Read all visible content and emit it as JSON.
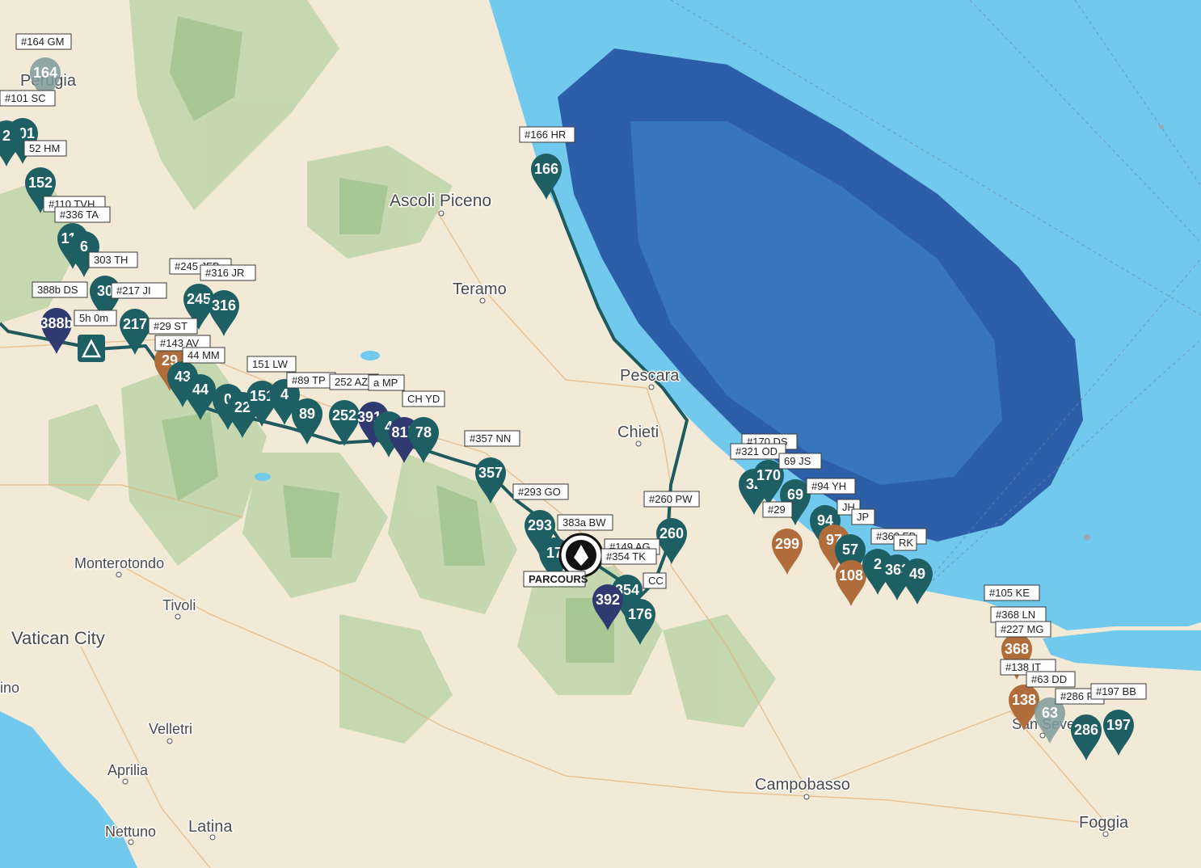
{
  "colors": {
    "sea": "#72c9ee",
    "deep_sea": "#2c5fa8",
    "land": "#f2e9d6",
    "hills": "#a9c99a",
    "route": "#1f5a5e",
    "pin_teal": "#1d5f63",
    "pin_brown": "#b06c3a",
    "pin_navy": "#2e3a70",
    "pin_grey": "#7f9b9b"
  },
  "cities": [
    {
      "name": "Perugia"
    },
    {
      "name": "Ascoli Piceno"
    },
    {
      "name": "Teramo"
    },
    {
      "name": "Pescara"
    },
    {
      "name": "Chieti"
    },
    {
      "name": "Monterotondo"
    },
    {
      "name": "Tivoli"
    },
    {
      "name": "Vatican City"
    },
    {
      "name": "Velletri"
    },
    {
      "name": "Aprilia"
    },
    {
      "name": "Nettuno"
    },
    {
      "name": "Latina"
    },
    {
      "name": "Campobasso"
    },
    {
      "name": "Foggia"
    },
    {
      "name": "San Severo"
    },
    {
      "name": "ino"
    }
  ],
  "labels": [
    {
      "text": "#164 GM"
    },
    {
      "text": "#101 SC"
    },
    {
      "text": "52 HM"
    },
    {
      "text": "#110 TVH"
    },
    {
      "text": "#336 TA"
    },
    {
      "text": "303 TH"
    },
    {
      "text": "#245 JFB"
    },
    {
      "text": "#316 JR"
    },
    {
      "text": "388b DS"
    },
    {
      "text": "#217 JI"
    },
    {
      "text": "5h 0m"
    },
    {
      "text": "#29 ST"
    },
    {
      "text": "#143 AV"
    },
    {
      "text": "44 MM"
    },
    {
      "text": "151 LW"
    },
    {
      "text": "#89 TP"
    },
    {
      "text": "252 AZ"
    },
    {
      "text": "a MP"
    },
    {
      "text": "CH YD"
    },
    {
      "text": "#166 HR"
    },
    {
      "text": "#357 NN"
    },
    {
      "text": "#293 GO"
    },
    {
      "text": "383a BW"
    },
    {
      "text": "#149 AG"
    },
    {
      "text": "#354 TK"
    },
    {
      "text": "CC"
    },
    {
      "text": "PARCOURS"
    },
    {
      "text": "#260 PW"
    },
    {
      "text": "#170 DS"
    },
    {
      "text": "#321 OD"
    },
    {
      "text": "69 JS"
    },
    {
      "text": "#94 YH"
    },
    {
      "text": "#29"
    },
    {
      "text": "JH"
    },
    {
      "text": "JP"
    },
    {
      "text": "#363 FB"
    },
    {
      "text": "RK"
    },
    {
      "text": "#105 KE"
    },
    {
      "text": "#368 LN"
    },
    {
      "text": "#227 MG"
    },
    {
      "text": "#138 IT"
    },
    {
      "text": "#63 DD"
    },
    {
      "text": "#286 F"
    },
    {
      "text": "#197 BB"
    }
  ],
  "pins": [
    {
      "num": "164",
      "color": "grey"
    },
    {
      "num": "101",
      "color": "teal"
    },
    {
      "num": "2",
      "color": "teal"
    },
    {
      "num": "152",
      "color": "teal"
    },
    {
      "num": "110",
      "color": "teal"
    },
    {
      "num": "6",
      "color": "teal"
    },
    {
      "num": "30",
      "color": "teal"
    },
    {
      "num": "388b",
      "color": "navy"
    },
    {
      "num": "245",
      "color": "teal"
    },
    {
      "num": "316",
      "color": "teal"
    },
    {
      "num": "217",
      "color": "teal"
    },
    {
      "num": "29",
      "color": "brown"
    },
    {
      "num": "43",
      "color": "teal"
    },
    {
      "num": "44",
      "color": "teal"
    },
    {
      "num": "0",
      "color": "teal"
    },
    {
      "num": "22",
      "color": "teal"
    },
    {
      "num": "151",
      "color": "teal"
    },
    {
      "num": "4",
      "color": "teal"
    },
    {
      "num": "89",
      "color": "teal"
    },
    {
      "num": "252",
      "color": "teal"
    },
    {
      "num": "391a",
      "color": "navy"
    },
    {
      "num": "4",
      "color": "teal"
    },
    {
      "num": "81b",
      "color": "navy"
    },
    {
      "num": "78",
      "color": "teal"
    },
    {
      "num": "166",
      "color": "teal"
    },
    {
      "num": "357",
      "color": "teal"
    },
    {
      "num": "293",
      "color": "teal"
    },
    {
      "num": "17",
      "color": "teal"
    },
    {
      "num": "260",
      "color": "teal"
    },
    {
      "num": "354",
      "color": "teal"
    },
    {
      "num": "392",
      "color": "navy"
    },
    {
      "num": "176",
      "color": "teal"
    },
    {
      "num": "32",
      "color": "teal"
    },
    {
      "num": "170",
      "color": "teal"
    },
    {
      "num": "69",
      "color": "teal"
    },
    {
      "num": "94",
      "color": "teal"
    },
    {
      "num": "299",
      "color": "brown"
    },
    {
      "num": "97",
      "color": "brown"
    },
    {
      "num": "57",
      "color": "teal"
    },
    {
      "num": "108",
      "color": "brown"
    },
    {
      "num": "2",
      "color": "teal"
    },
    {
      "num": "363",
      "color": "teal"
    },
    {
      "num": "49",
      "color": "teal"
    },
    {
      "num": "368",
      "color": "brown"
    },
    {
      "num": "138",
      "color": "brown"
    },
    {
      "num": "63",
      "color": "grey"
    },
    {
      "num": "286",
      "color": "teal"
    },
    {
      "num": "197",
      "color": "teal"
    }
  ]
}
